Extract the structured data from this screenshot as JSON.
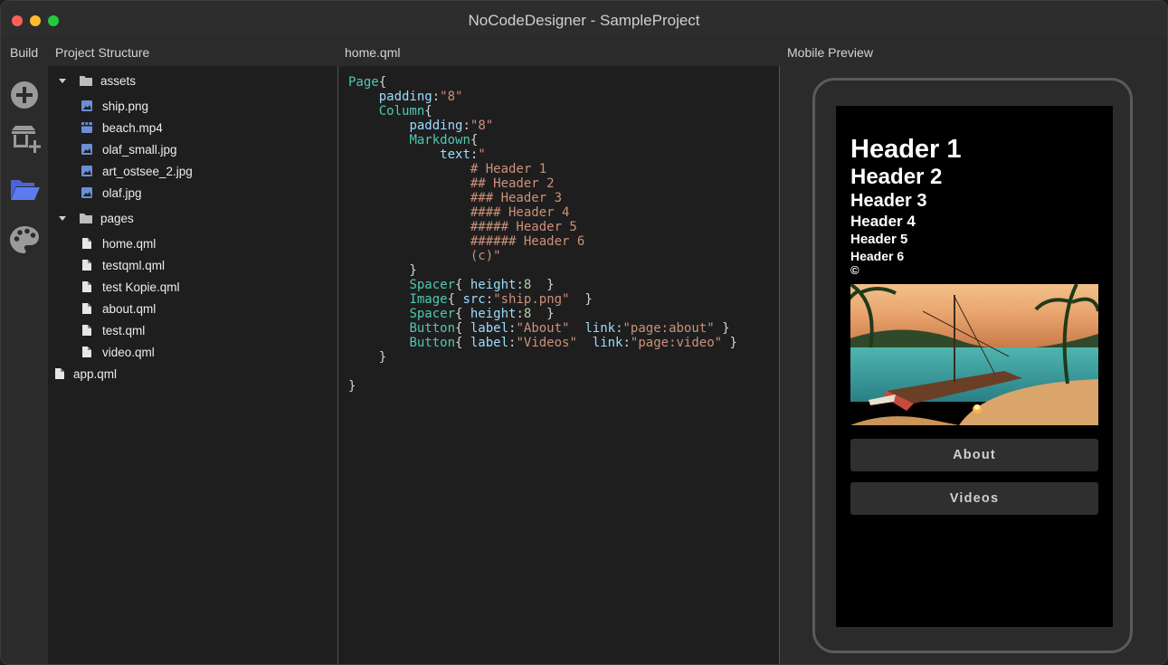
{
  "window": {
    "title": "NoCodeDesigner - SampleProject"
  },
  "header": {
    "build": "Build",
    "project_structure": "Project Structure",
    "editor_tab": "home.qml",
    "mobile_preview": "Mobile Preview"
  },
  "toolrail": {
    "icons": [
      "add-circle-icon",
      "add-component-icon",
      "folder-open-icon",
      "palette-icon"
    ]
  },
  "tree": {
    "assets_folder": "assets",
    "assets": [
      "ship.png",
      "beach.mp4",
      "olaf_small.jpg",
      "art_ostsee_2.jpg",
      "olaf.jpg"
    ],
    "pages_folder": "pages",
    "pages": [
      "home.qml",
      "testqml.qml",
      "test Kopie.qml",
      "about.qml",
      "test.qml",
      "video.qml"
    ],
    "root_file": "app.qml"
  },
  "editor": {
    "lines": [
      "Page{",
      "    padding:\"8\"",
      "    Column{",
      "        padding:\"8\"",
      "        Markdown{",
      "            text:\"",
      "                # Header 1",
      "                ## Header 2",
      "                ### Header 3",
      "                #### Header 4",
      "                ##### Header 5",
      "                ###### Header 6",
      "                (c)\"",
      "        }",
      "        Spacer{ height:8  }",
      "        Image{ src:\"ship.png\"  }",
      "        Spacer{ height:8  }",
      "        Button{ label:\"About\"  link:\"page:about\" }",
      "        Button{ label:\"Videos\"  link:\"page:video\" }",
      "    }",
      "",
      "}"
    ]
  },
  "preview": {
    "headers": [
      "Header 1",
      "Header 2",
      "Header 3",
      "Header 4",
      "Header 5",
      "Header 6"
    ],
    "copyright": "©",
    "image_alt": "ship.png",
    "buttons": [
      "About",
      "Videos"
    ]
  },
  "colors": {
    "accent_folder": "#5b7cf0",
    "image_file": "#6b8fd6",
    "keyword": "#4ec9b0",
    "property": "#9cdcfe",
    "string": "#ce9178"
  }
}
